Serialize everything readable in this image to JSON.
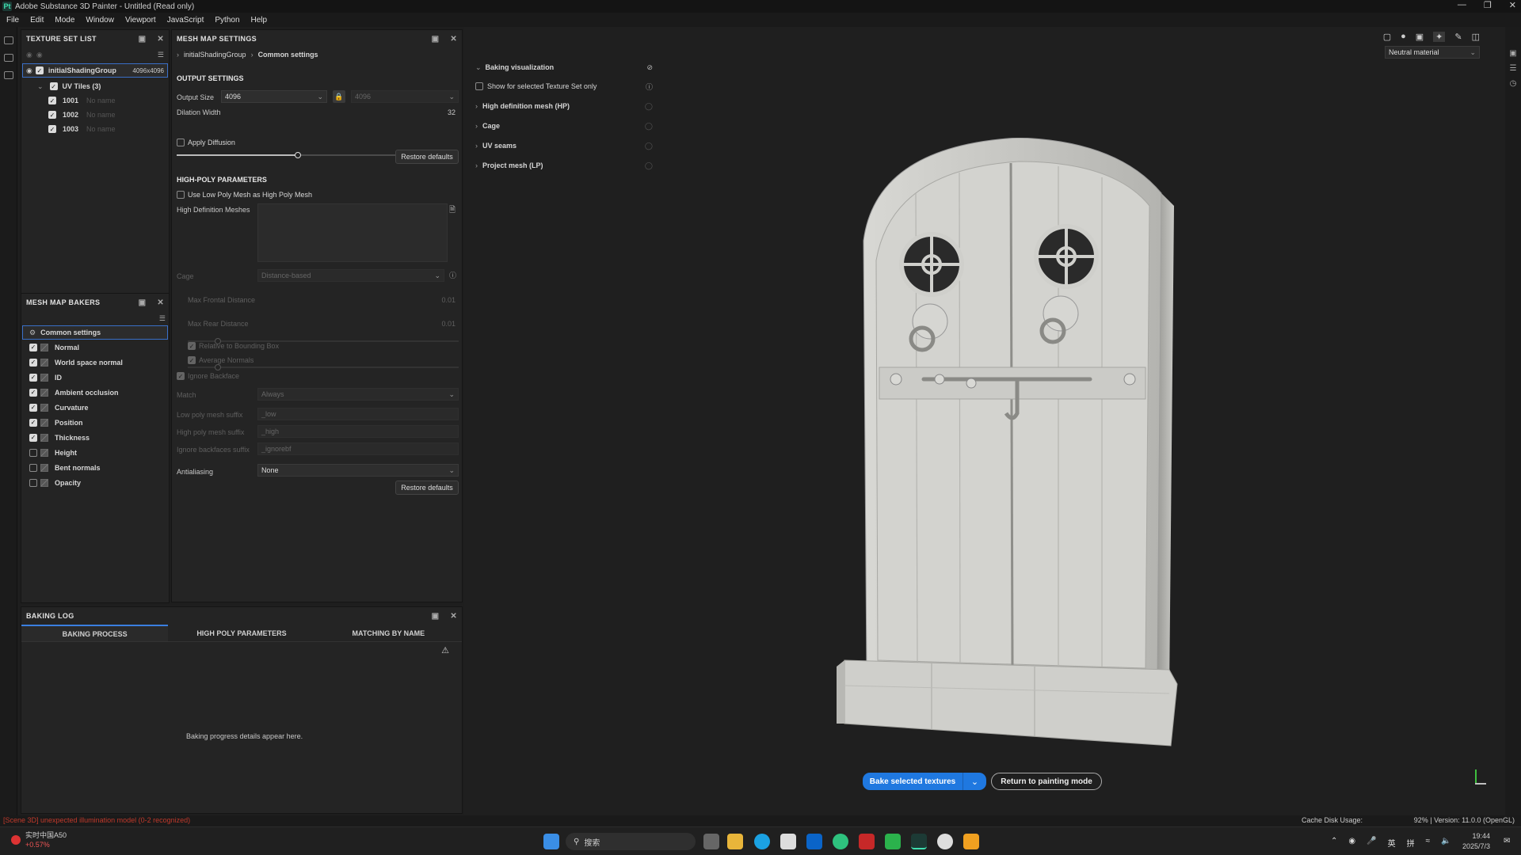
{
  "app": {
    "title": "Adobe Substance 3D Painter - Untitled (Read only)",
    "logo": "Pt"
  },
  "menu": [
    "File",
    "Edit",
    "Mode",
    "Window",
    "Viewport",
    "JavaScript",
    "Python",
    "Help"
  ],
  "texture_set_list": {
    "title": "TEXTURE SET LIST",
    "set_name": "initialShadingGroup",
    "set_size": "4096x4096",
    "uv_tiles_label": "UV Tiles (3)",
    "tiles": [
      {
        "id": "1001",
        "name": "No name"
      },
      {
        "id": "1002",
        "name": "No name"
      },
      {
        "id": "1003",
        "name": "No name"
      }
    ]
  },
  "mesh_map_bakers": {
    "title": "MESH MAP BAKERS",
    "common": "Common settings",
    "items": [
      {
        "label": "Normal",
        "checked": true
      },
      {
        "label": "World space normal",
        "checked": true
      },
      {
        "label": "ID",
        "checked": true
      },
      {
        "label": "Ambient occlusion",
        "checked": true
      },
      {
        "label": "Curvature",
        "checked": true
      },
      {
        "label": "Position",
        "checked": true
      },
      {
        "label": "Thickness",
        "checked": true
      },
      {
        "label": "Height",
        "checked": false
      },
      {
        "label": "Bent normals",
        "checked": false
      },
      {
        "label": "Opacity",
        "checked": false
      }
    ]
  },
  "mesh_map_settings": {
    "title": "MESH MAP SETTINGS",
    "breadcrumb": [
      "initialShadingGroup",
      "Common settings"
    ],
    "output_settings": "OUTPUT SETTINGS",
    "output_size_label": "Output Size",
    "output_size_value": "4096",
    "output_size_locked": "4096",
    "dilation_label": "Dilation Width",
    "dilation_value": "32",
    "dilation_fraction": 0.43,
    "apply_diffusion": "Apply Diffusion",
    "restore_defaults": "Restore defaults",
    "high_poly_title": "HIGH-POLY PARAMETERS",
    "use_low_poly": "Use Low Poly Mesh as High Poly Mesh",
    "hd_meshes_label": "High Definition Meshes",
    "cage_label": "Cage",
    "cage_value": "Distance-based",
    "max_frontal_label": "Max Frontal Distance",
    "max_frontal_value": "0.01",
    "max_rear_label": "Max Rear Distance",
    "max_rear_value": "0.01",
    "relative_bbox": "Relative to Bounding Box",
    "average_normals": "Average Normals",
    "ignore_backface": "Ignore Backface",
    "match_label": "Match",
    "match_value": "Always",
    "low_suffix_label": "Low poly mesh suffix",
    "low_suffix_value": "_low",
    "high_suffix_label": "High poly mesh suffix",
    "high_suffix_value": "_high",
    "ignore_suffix_label": "Ignore backfaces suffix",
    "ignore_suffix_value": "_ignorebf",
    "antialiasing_label": "Antialiasing",
    "antialiasing_value": "None",
    "restore_defaults_2": "Restore defaults"
  },
  "baking_viz": {
    "title": "Baking visualization",
    "show_selected": "Show for selected Texture Set only",
    "sections": [
      "High definition mesh (HP)",
      "Cage",
      "UV seams",
      "Project mesh (LP)"
    ]
  },
  "baking_log": {
    "title": "BAKING LOG",
    "tabs": [
      "BAKING PROCESS",
      "HIGH POLY PARAMETERS",
      "MATCHING BY NAME"
    ],
    "message": "Baking progress details appear here."
  },
  "viewport": {
    "material_dropdown": "Neutral material",
    "bake_button": "Bake selected textures",
    "return_button": "Return to painting mode"
  },
  "status": {
    "error": "[Scene 3D] unexpected illumination model (0-2 recognized)",
    "cache": "Cache Disk Usage:",
    "version": "92% | Version: 11.0.0 (OpenGL)"
  },
  "taskbar": {
    "search": "搜索",
    "weather_title": "实时中国A50",
    "weather_value": "+0.57%",
    "time": "19:44",
    "date": "2025/7/3",
    "ime1": "英",
    "ime2": "拼"
  },
  "colors": {
    "accent": "#1f78e0",
    "panel": "#242424",
    "viewport": "#1f1f1f",
    "error": "#c0392b"
  }
}
